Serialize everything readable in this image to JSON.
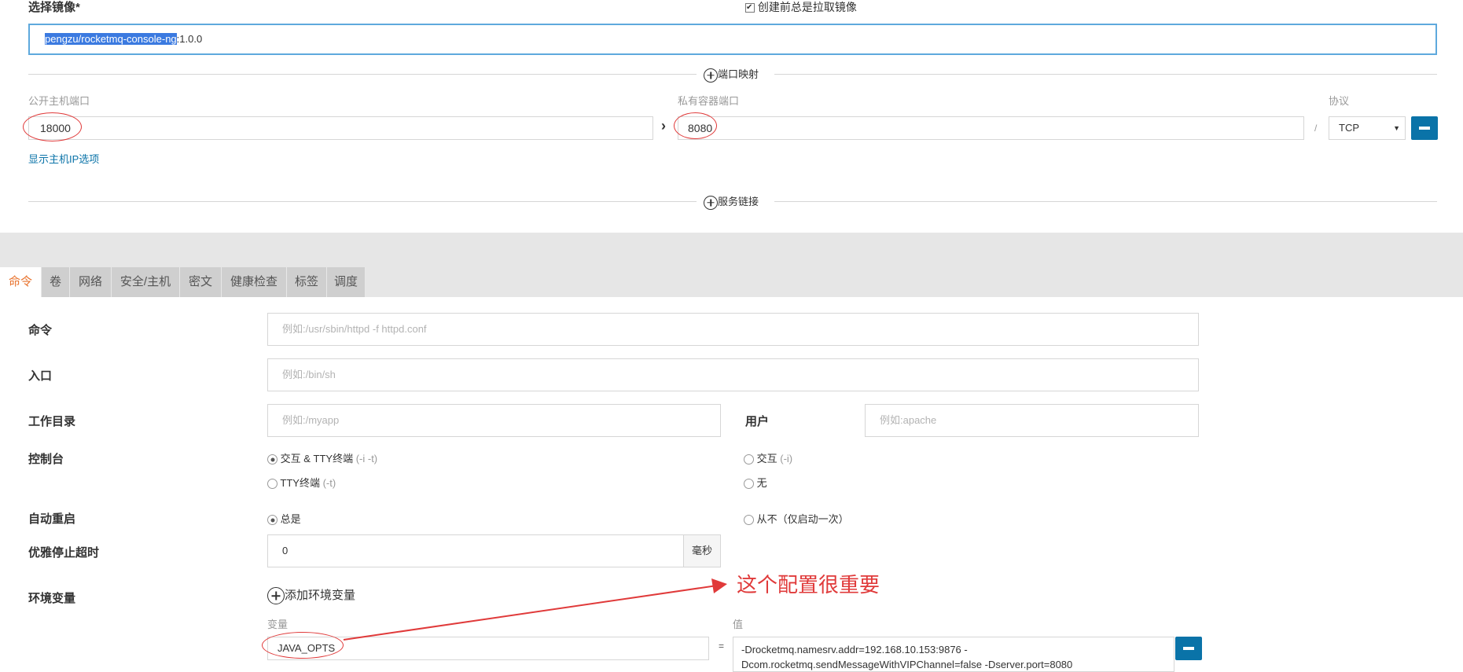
{
  "image_section": {
    "label": "选择镜像*",
    "pull_checkbox_label": "创建前总是拉取镜像",
    "pull_checked": true,
    "image_value_selected": "pengzu/rocketmq-console-ng",
    "image_value_rest": ":1.0.0"
  },
  "port_mapping": {
    "section_label": "端口映射",
    "host_port_label": "公开主机端口",
    "host_port_value": "18000",
    "container_port_label": "私有容器端口",
    "container_port_value": "8080",
    "protocol_label": "协议",
    "protocol_value": "TCP",
    "separator": "/",
    "show_host_ip_link": "显示主机IP选项"
  },
  "service_link": {
    "section_label": "服务链接"
  },
  "tabs": [
    {
      "label": "命令",
      "active": true
    },
    {
      "label": "卷"
    },
    {
      "label": "网络"
    },
    {
      "label": "安全/主机"
    },
    {
      "label": "密文"
    },
    {
      "label": "健康检查"
    },
    {
      "label": "标签"
    },
    {
      "label": "调度"
    }
  ],
  "command_form": {
    "command_label": "命令",
    "command_placeholder": "例如:/usr/sbin/httpd -f httpd.conf",
    "entry_label": "入口",
    "entry_placeholder": "例如:/bin/sh",
    "workdir_label": "工作目录",
    "workdir_placeholder": "例如:/myapp",
    "user_label": "用户",
    "user_placeholder": "例如:apache",
    "console_label": "控制台",
    "console_options": {
      "interactive_tty": "交互 & TTY终端",
      "interactive_tty_hint": "(-i -t)",
      "interactive": "交互",
      "interactive_hint": "(-i)",
      "tty": "TTY终端",
      "tty_hint": "(-t)",
      "none": "无"
    },
    "restart_label": "自动重启",
    "restart_options": {
      "always": "总是",
      "never": "从不（仅启动一次）"
    },
    "stop_timeout_label": "优雅停止超时",
    "stop_timeout_value": "0",
    "stop_timeout_unit": "毫秒",
    "env_label": "环境变量",
    "add_env_label": "添加环境变量",
    "env_var_col": "变量",
    "env_value_col": "值",
    "env_equals": "=",
    "env_rows": [
      {
        "name": "JAVA_OPTS",
        "value_line1": "-Drocketmq.namesrv.addr=192.168.10.153:9876 -",
        "value_line2": "Dcom.rocketmq.sendMessageWithVIPChannel=false -Dserver.port=8080"
      }
    ]
  },
  "annotation": {
    "text": "这个配置很重要",
    "color": "#e03a3a"
  }
}
